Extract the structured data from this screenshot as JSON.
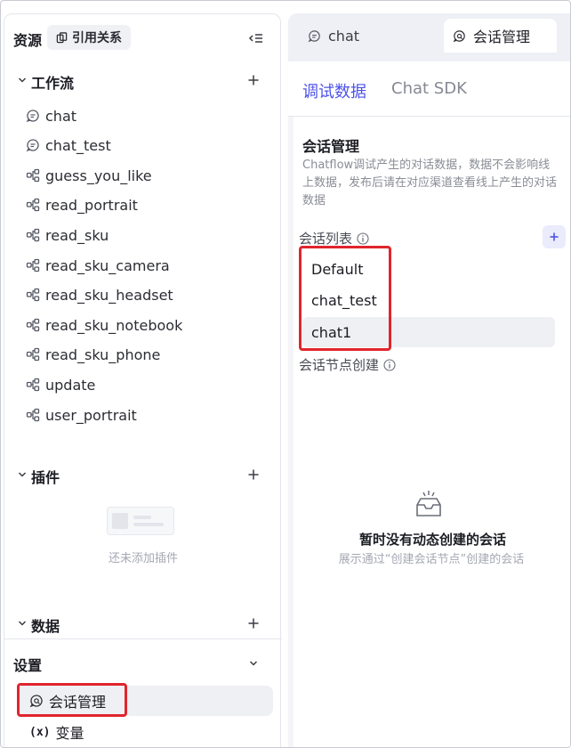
{
  "sidebar": {
    "title": "资源",
    "ref_button": "引用关系",
    "workflow": {
      "label": "工作流",
      "items": [
        {
          "label": "chat",
          "icon": "chat-icon"
        },
        {
          "label": "chat_test",
          "icon": "chat-icon"
        },
        {
          "label": "guess_you_like",
          "icon": "workflow-icon"
        },
        {
          "label": "read_portrait",
          "icon": "workflow-icon"
        },
        {
          "label": "read_sku",
          "icon": "workflow-icon"
        },
        {
          "label": "read_sku_camera",
          "icon": "workflow-icon"
        },
        {
          "label": "read_sku_headset",
          "icon": "workflow-icon"
        },
        {
          "label": "read_sku_notebook",
          "icon": "workflow-icon"
        },
        {
          "label": "read_sku_phone",
          "icon": "workflow-icon"
        },
        {
          "label": "update",
          "icon": "workflow-icon"
        },
        {
          "label": "user_portrait",
          "icon": "workflow-icon"
        }
      ]
    },
    "plugin": {
      "label": "插件",
      "empty_text": "还未添加插件"
    },
    "data": {
      "label": "数据"
    },
    "settings": {
      "label": "设置",
      "items": [
        {
          "label": "会话管理",
          "icon": "conversation-icon"
        },
        {
          "label": "变量",
          "icon": "variable-icon"
        }
      ]
    }
  },
  "tabs": [
    {
      "label": "chat",
      "icon": "chat-icon"
    },
    {
      "label": "会话管理",
      "icon": "conversation-icon"
    }
  ],
  "panel": {
    "sub_tabs": [
      {
        "label": "调试数据",
        "active": true
      },
      {
        "label": "Chat SDK",
        "active": false
      }
    ],
    "section_title": "会话管理",
    "section_desc": "Chatflow调试产生的对话数据，数据不会影响线上数据，发布后请在对应渠道查看线上产生的对话数据",
    "list_label": "会话列表",
    "conversations": [
      "Default",
      "chat_test",
      "chat1"
    ],
    "selected_conversation": "chat1",
    "node_label": "会话节点创建",
    "empty_title": "暂时没有动态创建的会话",
    "empty_desc": "展示通过“创建会话节点”创建的会话"
  },
  "colors": {
    "accent": "#4d53e8",
    "highlight_box": "#e0252d",
    "muted_text": "#8a8d96"
  }
}
